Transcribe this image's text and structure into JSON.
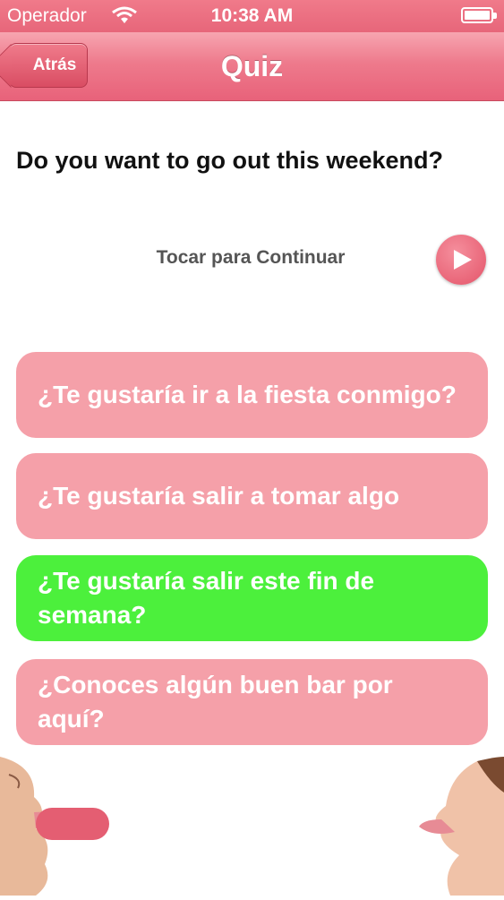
{
  "status_bar": {
    "carrier": "Operador",
    "time": "10:38 AM"
  },
  "nav": {
    "back_label": "Atrás",
    "title": "Quiz"
  },
  "question": "Do you want to go out this weekend?",
  "continue_label": "Tocar para Continuar",
  "answers": [
    {
      "text": "¿Te gustaría ir a la fiesta conmigo?",
      "state": "default"
    },
    {
      "text": "¿Te gustaría salir a tomar algo",
      "state": "default"
    },
    {
      "text": "¿Te gustaría salir este fin de semana?",
      "state": "correct"
    },
    {
      "text": "¿Conoces algún buen bar por aquí?",
      "state": "default"
    }
  ],
  "colors": {
    "accent": "#e8627a",
    "answer_default": "#f5a0a9",
    "answer_correct": "#4cf03c"
  },
  "icons": {
    "wifi": "wifi-icon",
    "battery": "battery-icon",
    "play": "play-icon"
  }
}
